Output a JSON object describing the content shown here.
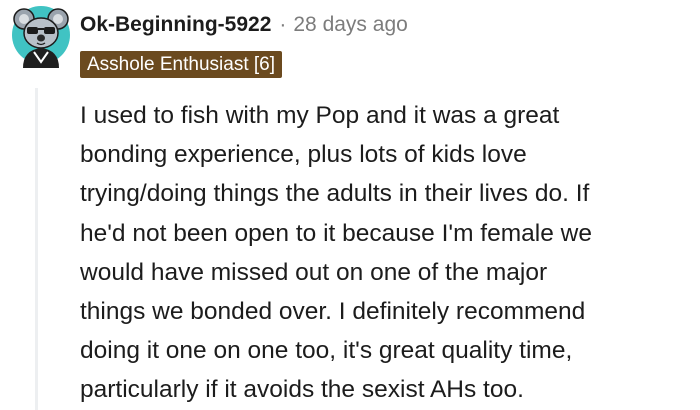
{
  "comment": {
    "author": "Ok-Beginning-5922",
    "separator": "·",
    "timestamp": "28 days ago",
    "flair": "Asshole Enthusiast [6]",
    "avatar_icon": "koala-snoo-avatar-icon",
    "body_lines": [
      "I used to fish with my Pop and it was a great",
      "bonding experience, plus lots of kids love",
      "trying/doing things the adults in their lives do. If",
      "he'd not been open to it because I'm female we",
      "would have missed out on one of the major",
      "things we bonded over. I definitely recommend",
      "doing it one on one too, it's great quality time,",
      "particularly if it avoids the sexist AHs too."
    ]
  },
  "colors": {
    "flair_background": "#6b4a1f",
    "avatar_background": "#40c3c3",
    "meta_text": "#7c7c7c",
    "thread_line": "#edeff1"
  }
}
